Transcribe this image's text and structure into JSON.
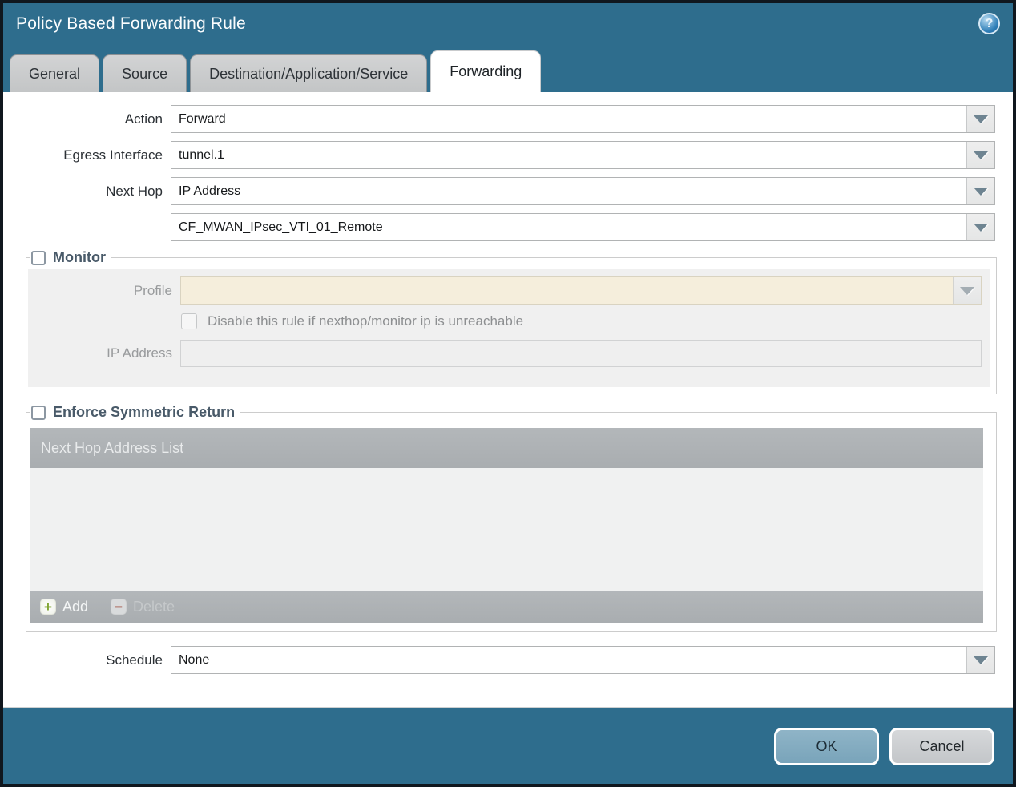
{
  "dialog": {
    "title": "Policy Based Forwarding Rule",
    "help_icon": "question-mark"
  },
  "tabs": [
    {
      "label": "General",
      "active": false
    },
    {
      "label": "Source",
      "active": false
    },
    {
      "label": "Destination/Application/Service",
      "active": false
    },
    {
      "label": "Forwarding",
      "active": true
    }
  ],
  "form": {
    "action": {
      "label": "Action",
      "value": "Forward"
    },
    "egress_interface": {
      "label": "Egress Interface",
      "value": "tunnel.1"
    },
    "next_hop": {
      "label": "Next Hop",
      "value": "IP Address"
    },
    "next_hop_address": {
      "value": "CF_MWAN_IPsec_VTI_01_Remote"
    },
    "schedule": {
      "label": "Schedule",
      "value": "None"
    }
  },
  "monitor": {
    "legend": "Monitor",
    "checked": false,
    "profile": {
      "label": "Profile",
      "value": ""
    },
    "disable_checkbox": {
      "label": "Disable this rule if nexthop/monitor ip is unreachable",
      "checked": false
    },
    "ip_address": {
      "label": "IP Address",
      "value": ""
    }
  },
  "symmetric_return": {
    "legend": "Enforce Symmetric Return",
    "checked": false,
    "table": {
      "header": "Next Hop Address List",
      "rows": []
    },
    "add_label": "Add",
    "delete_label": "Delete",
    "delete_enabled": false
  },
  "footer": {
    "ok_label": "OK",
    "cancel_label": "Cancel"
  },
  "colors": {
    "teal": "#2e6d8d",
    "ok": "#79a4ba",
    "grid_gray": "#aeb2b5",
    "cream_field": "#f5eedc"
  }
}
